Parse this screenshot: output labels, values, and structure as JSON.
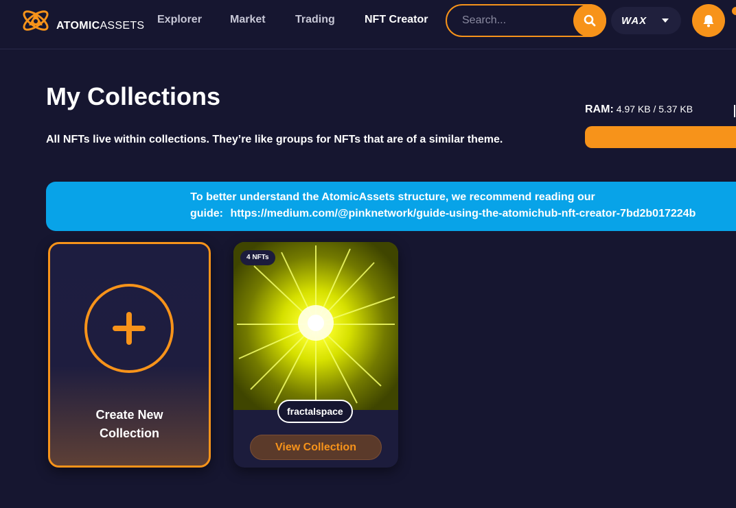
{
  "brand": {
    "logo_bold": "ATOMIC",
    "logo_light": "ASSETS",
    "accent_color": "#f7931a",
    "logo_icon": "atom-logo-icon"
  },
  "nav": {
    "items": [
      {
        "label": "Explorer"
      },
      {
        "label": "Market"
      },
      {
        "label": "Trading"
      },
      {
        "label": "NFT Creator",
        "active": true
      }
    ]
  },
  "search": {
    "placeholder": "Search...",
    "icon": "search-icon"
  },
  "chain_selector": {
    "label": "WAX",
    "icon": "caret-down-icon"
  },
  "notifications": {
    "icon": "bell-icon"
  },
  "page": {
    "title": "My Collections",
    "description": "All NFTs live within collections. They’re like groups for NFTs that are of a similar theme."
  },
  "ram": {
    "label": "RAM:",
    "value": "4.97 KB / 5.37 KB",
    "usage_fraction": 0.925
  },
  "banner": {
    "line1": "To better understand the AtomicAssets structure, we recommend reading our",
    "prefix": "guide:",
    "link_text": "https://medium.com/@pinknetwork/guide-using-the-atomichub-nft-creator-7bd2b017224b",
    "color": "#08a3e8"
  },
  "create_card": {
    "label": "Create New Collection",
    "icon": "plus-icon"
  },
  "collections": [
    {
      "badge": "4 NFTs",
      "name": "fractalspace",
      "button_label": "View Collection",
      "image": "yellow-starburst-image"
    }
  ]
}
